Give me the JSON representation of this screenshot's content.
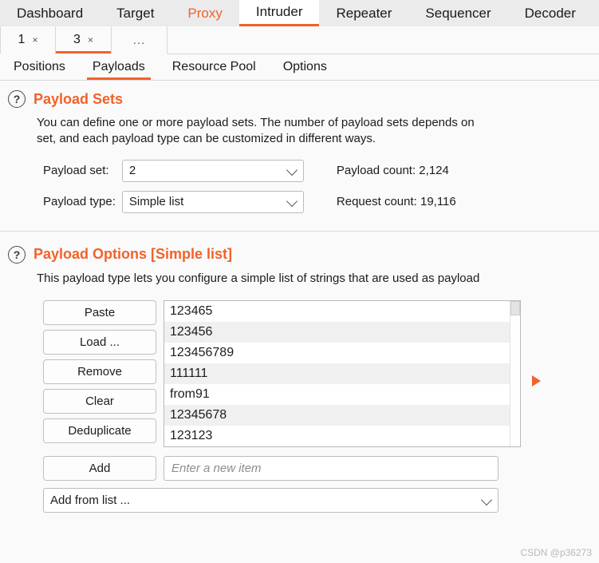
{
  "top_tabs": [
    {
      "label": "Dashboard",
      "active": false,
      "accent": false
    },
    {
      "label": "Target",
      "active": false,
      "accent": false
    },
    {
      "label": "Proxy",
      "active": false,
      "accent": true
    },
    {
      "label": "Intruder",
      "active": true,
      "accent": false
    },
    {
      "label": "Repeater",
      "active": false,
      "accent": false
    },
    {
      "label": "Sequencer",
      "active": false,
      "accent": false
    },
    {
      "label": "Decoder",
      "active": false,
      "accent": false
    }
  ],
  "attack_tabs": [
    {
      "label": "1",
      "close": "×",
      "active": false
    },
    {
      "label": "3",
      "close": "×",
      "active": true
    }
  ],
  "attack_tabs_more": "...",
  "sub_tabs": [
    {
      "label": "Positions",
      "active": false
    },
    {
      "label": "Payloads",
      "active": true
    },
    {
      "label": "Resource Pool",
      "active": false
    },
    {
      "label": "Options",
      "active": false
    }
  ],
  "payload_sets": {
    "help_icon": "question-mark-icon",
    "title": "Payload Sets",
    "description_line1": "You can define one or more payload sets. The number of payload sets depends on",
    "description_line2": "set, and each payload type can be customized in different ways.",
    "payload_set_label": "Payload set:",
    "payload_set_value": "2",
    "payload_type_label": "Payload type:",
    "payload_type_value": "Simple list",
    "payload_count": "Payload count: 2,124",
    "request_count": "Request count: 19,116"
  },
  "payload_options": {
    "help_icon": "question-mark-icon",
    "title": "Payload Options [Simple list]",
    "description": "This payload type lets you configure a simple list of strings that are used as payload",
    "buttons": [
      "Paste",
      "Load ...",
      "Remove",
      "Clear",
      "Deduplicate"
    ],
    "list_items": [
      "123465",
      "123456",
      "123456789",
      "111111",
      "from91",
      "12345678",
      "123123"
    ],
    "add_button": "Add",
    "new_item_placeholder": "Enter a new item",
    "add_from_list_label": "Add from list ..."
  },
  "watermark": "CSDN @p36273",
  "colors": {
    "accent": "#f2622a",
    "topbar_bg": "#ebebeb",
    "panel_bg": "#fafafa",
    "text": "#1c1c1c"
  }
}
